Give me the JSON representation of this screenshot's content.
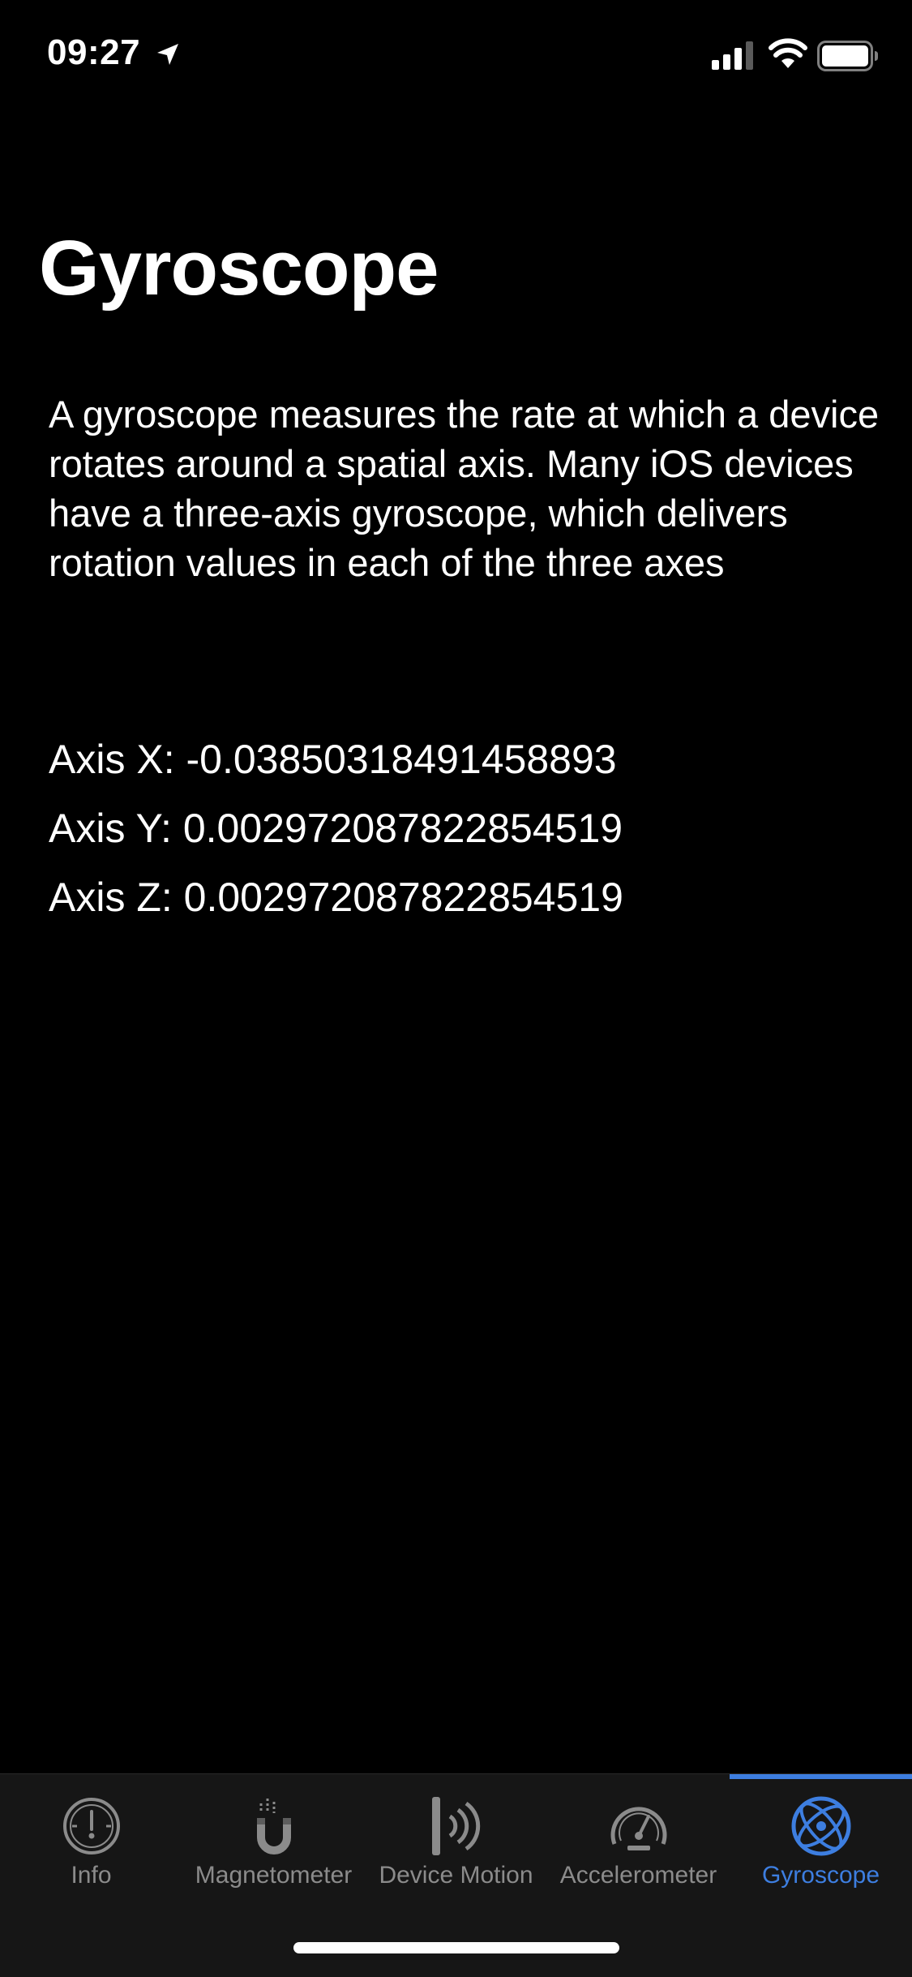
{
  "status_bar": {
    "time": "09:27",
    "icons": [
      "location-arrow-icon",
      "cellular-signal-icon",
      "wifi-icon",
      "battery-icon"
    ]
  },
  "page": {
    "title": "Gyroscope",
    "description": "A gyroscope measures the rate at which a device rotates around a spatial axis. Many iOS devices have a three-axis gyroscope, which delivers rotation values in each of the three axes"
  },
  "axes": {
    "x": "Axis X: -0.03850318491458893",
    "y": "Axis Y: 0.002972087822854519",
    "z": "Axis Z: 0.002972087822854519"
  },
  "tab_bar": {
    "active_color": "#3d7ee0",
    "inactive_color": "#8b8b8b",
    "items": [
      {
        "label": "Info",
        "icon": "info-gauge-icon",
        "active": false
      },
      {
        "label": "Magnetometer",
        "icon": "magnet-icon",
        "active": false
      },
      {
        "label": "Device Motion",
        "icon": "vibration-icon",
        "active": false
      },
      {
        "label": "Accelerometer",
        "icon": "speedometer-icon",
        "active": false
      },
      {
        "label": "Gyroscope",
        "icon": "gyroscope-icon",
        "active": true
      }
    ]
  }
}
